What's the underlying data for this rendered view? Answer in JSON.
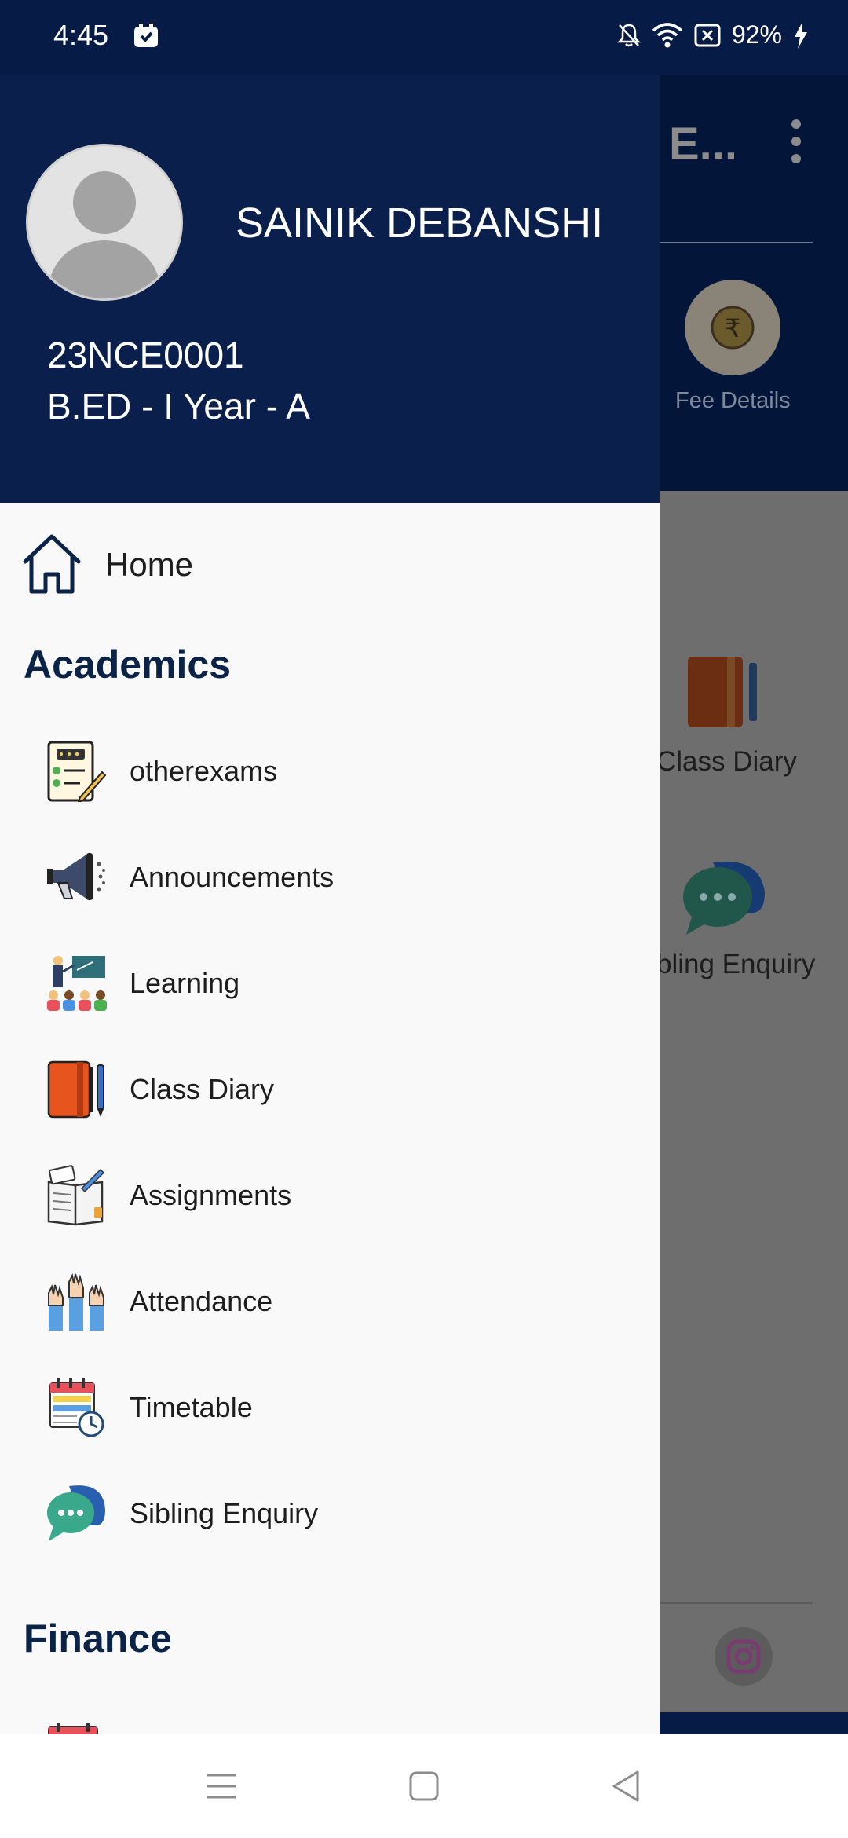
{
  "status_bar": {
    "time": "4:45",
    "battery": "92%"
  },
  "background_app": {
    "title": "E...",
    "fee_label": "Fee Details",
    "diary_label": "Class Diary",
    "sibling_label": "bling Enquiry"
  },
  "drawer": {
    "user": {
      "name": "SAINIK DEBANSHI",
      "id": "23NCE0001",
      "class": "B.ED - I Year - A"
    },
    "home_label": "Home",
    "academics_title": "Academics",
    "academics_items": [
      {
        "label": "otherexams",
        "icon": "exam-sheet-icon"
      },
      {
        "label": "Announcements",
        "icon": "megaphone-icon"
      },
      {
        "label": "Learning",
        "icon": "classroom-icon"
      },
      {
        "label": "Class Diary",
        "icon": "diary-icon"
      },
      {
        "label": "Assignments",
        "icon": "assignment-icon"
      },
      {
        "label": "Attendance",
        "icon": "raised-hands-icon"
      },
      {
        "label": "Timetable",
        "icon": "calendar-clock-icon"
      },
      {
        "label": "Sibling Enquiry",
        "icon": "chat-bubbles-icon"
      }
    ],
    "finance_title": "Finance"
  }
}
